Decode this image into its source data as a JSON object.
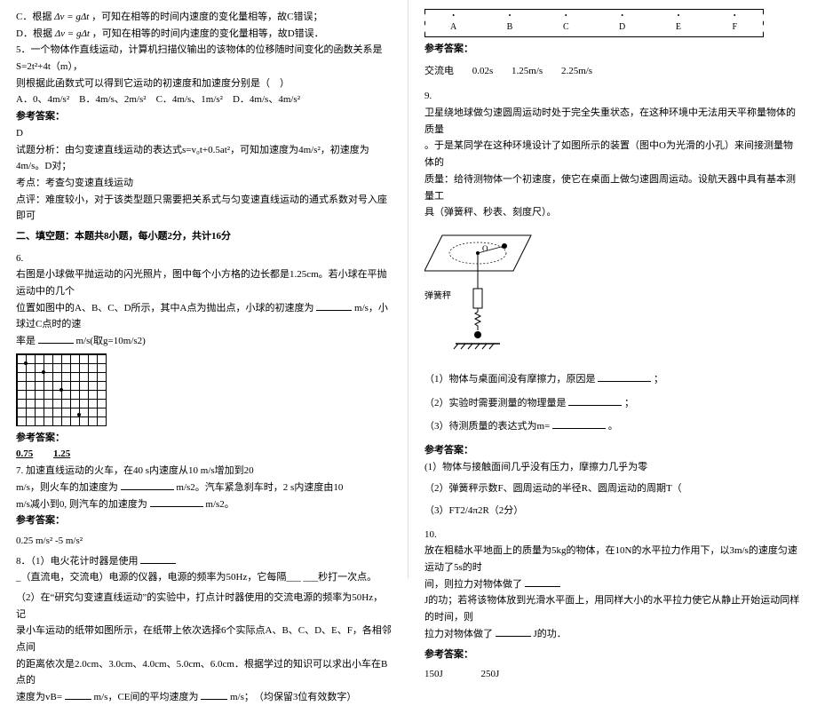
{
  "left": {
    "c_line": "C．根据",
    "c_formula": "Δv = gΔt",
    "c_tail": "，可知在相等的时间内速度的变化量相等，故C错误；",
    "d_line": "D．根据",
    "d_formula": "Δv = gΔt",
    "d_tail": "，可知在相等的时间内速度的变化量相等，故D错误．",
    "q5": "5．一个物体作直线运动，计算机扫描仪输出的该物体的位移随时间变化的函数关系是S=2t²+4t（m），",
    "q5_b": "则根据此函数式可以得到它运动的初速度和加速度分别是（　）",
    "q5_opts": {
      "A": "A．0、4m/s²",
      "B": "B．4m/s、2m/s²",
      "C": "C．4m/s、1m/s²",
      "D": "D．4m/s、4m/s²"
    },
    "ans_label": "参考答案：",
    "q5_ans": "D",
    "q5_exp1": "试题分析：由匀变速直线运动的表达式s=v₀t+0.5at²，可知加速度为4m/s²，初速度为4m/s。D对；",
    "q5_exp2": "考点：考查匀变速直线运动",
    "q5_exp3": "点评：难度较小，对于该类型题只需要把关系式与匀变速直线运动的通式系数对号入座即可",
    "section2": "二、填空题：本题共8小题，每小题2分，共计16分",
    "q6_n": "6.",
    "q6_a": "右图是小球做平抛运动的闪光照片，图中每个小方格的边长都是1.25cm。若小球在平抛运动中的几个",
    "q6_b": "位置如图中的A、B、C、D所示，其中A点为抛出点，小球的初速度为",
    "q6_c": "m/s，小球过C点时的速",
    "q6_d": "率是",
    "q6_e": "m/s(取g=10m/s2)",
    "q6_ans1": "0.75",
    "q6_ans2": "1.25",
    "q7": "7. 加速直线运动的火车，在40 s内速度从10 m/s增加到20",
    "q7_b": "m/s，则火车的加速度为",
    "q7_c": "m/s2。汽车紧急刹车时，2 s内速度由10",
    "q7_d": "m/s减小到0, 则汽车的加速度为",
    "q7_e": "m/s2。",
    "q7_ans": "0.25 m/s² -5 m/s²",
    "q8_1a": "8．（1）电火花计时器是使用",
    "q8_1b": "_（直流电，交流电）电源的仪器，电源的频率为50Hz，它每隔___  ___秒打一次点。",
    "q8_2a": "（2）在“研究匀变速直线运动”的实验中，打点计时器使用的交流电源的频率为50Hz，记",
    "q8_2b": "录小车运动的纸带如图所示，在纸带上依次选择6个实际点A、B、C、D、E、F，各相邻点间",
    "q8_2c": "的距离依次是2.0cm、3.0cm、4.0cm、5.0cm、6.0cm．根据学过的知识可以求出小车在B点的",
    "q8_2d": "速度为vB=",
    "q8_2e": "m/s，CE间的平均速度为",
    "q8_2f": "m/s；　（均保留3位有效数字）"
  },
  "right": {
    "tape_labels": [
      "A",
      "B",
      "C",
      "D",
      "E",
      "F"
    ],
    "ans_label": "参考答案：",
    "q8_ans": {
      "a": "交流电",
      "b": "0.02s",
      "c": "1.25m/s",
      "d": "2.25m/s"
    },
    "q9_n": "9.",
    "q9_a": "卫星绕地球做匀速圆周运动时处于完全失重状态，在这种环境中无法用天平称量物体的质量",
    "q9_b": "。于是某同学在这种环境设计了如图所示的装置（图中O为光滑的小孔）来间接测量物体的",
    "q9_c": "质量：给待测物体一个初速度，使它在桌面上做匀速圆周运动。设航天器中具有基本测量工",
    "q9_d": "具（弹簧秤、秒表、刻度尺）。",
    "spring": "弹簧秤",
    "q9_q1a": "（1）物体与桌面间没有摩擦力，原因是",
    "q9_q1b": "；",
    "q9_q2a": "（2）实验时需要测量的物理量是",
    "q9_q2b": "；",
    "q9_q3a": "（3）待测质量的表达式为m=",
    "q9_q3b": "。",
    "q9_ansA": "(1）物体与接触面间几乎没有压力，摩擦力几乎为零",
    "q9_ansB": "（2）弹簧秤示数F、圆周运动的半径R、圆周运动的周期T（",
    "q9_ansC": "（3）FT2/4π2R（2分）",
    "q10_n": "10.",
    "q10_a": "放在粗糙水平地面上的质量为5kg的物体，在10N的水平拉力作用下，以3m/s的速度匀速运动了5s的时",
    "q10_b": "间，则拉力对物体做了",
    "q10_c": "J的功；若将该物体放到光滑水平面上，用同样大小的水平拉力使它从静止开始运动同样的时间，则",
    "q10_d": "拉力对物体做了",
    "q10_e": "J的功．",
    "q10_ans1": "150J",
    "q10_ans2": "250J"
  }
}
